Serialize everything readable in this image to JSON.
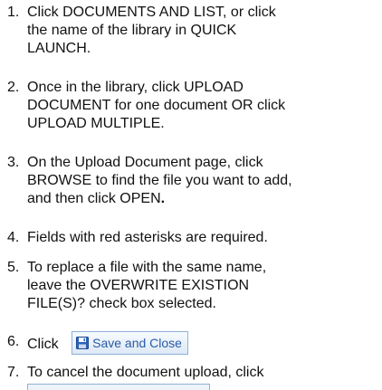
{
  "steps": [
    {
      "num": "1.",
      "lines": [
        "Click DOCUMENTS AND LIST, or click",
        "the name of the library in QUICK",
        "LAUNCH."
      ]
    },
    {
      "num": "2.",
      "lines": [
        "Once in the library, click UPLOAD",
        "DOCUMENT for one document OR click",
        "UPLOAD MULTIPLE."
      ]
    },
    {
      "num": "3.",
      "lines": [
        "On the Upload Document page, click",
        "BROWSE to find the file you want to add,",
        "and then click OPEN"
      ],
      "trailing_bold": "."
    },
    {
      "num": "4.",
      "lines": [
        "Fields with red asterisks are required."
      ]
    },
    {
      "num": "5.",
      "lines": [
        "To replace a file with the same name,",
        "leave the OVERWRITE EXISTION",
        "FILE(S)? check box selected."
      ]
    },
    {
      "num": "6.",
      "lines": [
        "Click"
      ],
      "button": {
        "label": "Save and Close",
        "icon": "save-icon"
      }
    },
    {
      "num": "7.",
      "lines": [
        "To cancel the document upload, click"
      ]
    }
  ],
  "colors": {
    "button_border": "#8fb1d8",
    "button_text": "#2a5aa5",
    "icon_blue": "#2b63b8"
  }
}
